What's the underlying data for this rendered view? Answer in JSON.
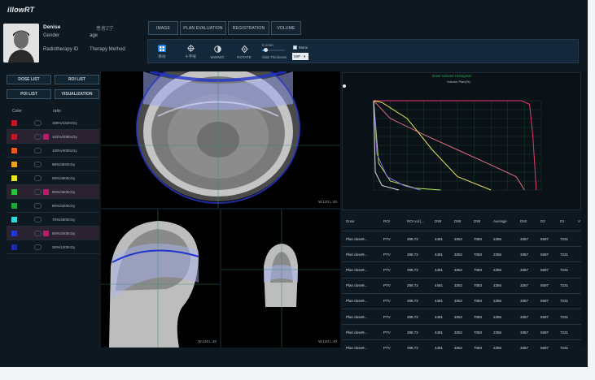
{
  "app": {
    "logo": "iIlowRT"
  },
  "patient": {
    "name": "Denise",
    "name_cn": "患者Z宁",
    "gender_label": "Gender",
    "age_label": "age",
    "radiotherapy_id_label": "Radiotherapy ID",
    "therapy_method_label": "Therapy Method"
  },
  "top_tabs": [
    "IMAGE",
    "PLAN EVALUATION",
    "REGISTRATION",
    "VOLUME"
  ],
  "toolbar": {
    "tools": [
      {
        "label": "移动",
        "icon": "grid-icon",
        "active": true
      },
      {
        "label": "十字线",
        "icon": "crosshair-icon",
        "active": false
      },
      {
        "label": "WW/WC",
        "icon": "contrast-icon",
        "active": false
      },
      {
        "label": "ROTATE",
        "icon": "rotate-icon",
        "active": false
      }
    ],
    "slab_thickness_label": "Slab Thickness",
    "slab_value": "0.1mm",
    "mono_label": "Mono",
    "mip_value": "MIP"
  },
  "left_panel": {
    "buttons": [
      "DOSE LIST",
      "ROI LIST",
      "POI LIST",
      "VISUALIZATION"
    ],
    "col_color": "Color",
    "col_ratio": "ratio",
    "rows": [
      {
        "color": "#c2172a",
        "flag": "",
        "ratio": "108%/4320cGy"
      },
      {
        "color": "#c2172a",
        "flag": "#c2176a",
        "ratio": "102%/4080cGy"
      },
      {
        "color": "#e8581a",
        "flag": "",
        "ratio": "100%/4000cGy"
      },
      {
        "color": "#f0a020",
        "flag": "",
        "ratio": "98%/3920cGy"
      },
      {
        "color": "#e6e61a",
        "flag": "",
        "ratio": "95%/3800cGy"
      },
      {
        "color": "#27c43a",
        "flag": "#c2176a",
        "ratio": "90%/3600cGy"
      },
      {
        "color": "#1fa83a",
        "flag": "",
        "ratio": "80%/3200cGy"
      },
      {
        "color": "#2fd6e0",
        "flag": "",
        "ratio": "70%/2800cGy"
      },
      {
        "color": "#2436d8",
        "flag": "#c2176a",
        "ratio": "50%/2000cGy"
      },
      {
        "color": "#1a2aa8",
        "flag": "",
        "ratio": "30%/1200cGy"
      }
    ]
  },
  "viewers": {
    "axial_wl": "W:120 L:40",
    "sagittal_wl": "W:120 L:40",
    "coronal_wl": "W:120 L:40"
  },
  "dvh": {
    "title": "Dose Volume Histogram",
    "subtitle": "Volume Plan(%)"
  },
  "chart_data": {
    "type": "line",
    "title": "Dose Volume Histogram",
    "ylabel": "Volume Plan(%)",
    "xlim": [
      0,
      100
    ],
    "ylim": [
      0,
      100
    ],
    "grid": true,
    "series": [
      {
        "color": "#e33a6a",
        "x": [
          0,
          88,
          93,
          95,
          97
        ],
        "y": [
          100,
          100,
          96,
          60,
          0
        ]
      },
      {
        "color": "#e06a82",
        "x": [
          0,
          10,
          30,
          50,
          70,
          85,
          90
        ],
        "y": [
          100,
          80,
          62,
          45,
          28,
          15,
          0
        ]
      },
      {
        "color": "#e6e25a",
        "x": [
          0,
          5,
          20,
          35,
          50,
          70
        ],
        "y": [
          100,
          98,
          80,
          45,
          15,
          0
        ]
      },
      {
        "color": "#b5e35a",
        "x": [
          0,
          3,
          10,
          25,
          40
        ],
        "y": [
          100,
          30,
          10,
          2,
          0
        ]
      },
      {
        "color": "#8a6ae0",
        "x": [
          0,
          2,
          8,
          18,
          28
        ],
        "y": [
          100,
          40,
          15,
          5,
          0
        ]
      },
      {
        "color": "#e0e0e0",
        "x": [
          0,
          1,
          5,
          15
        ],
        "y": [
          100,
          20,
          5,
          0
        ]
      }
    ]
  },
  "table": {
    "headers": [
      "Dose",
      "ROI",
      "ROI vol.[...",
      "D99",
      "D98",
      "D95",
      "Average",
      "D50",
      "D2",
      "D1",
      "V"
    ],
    "rows": [
      [
        "Plan dose9...",
        "PTV",
        "298.72",
        "4481",
        "3352",
        "7083",
        "2356",
        "3367",
        "5597",
        "7231"
      ],
      [
        "Plan dose9...",
        "PTV",
        "298.72",
        "4481",
        "3352",
        "7083",
        "2356",
        "3367",
        "5597",
        "7231"
      ],
      [
        "Plan dose9...",
        "PTV",
        "298.72",
        "4481",
        "3352",
        "7083",
        "2356",
        "3367",
        "5597",
        "7231"
      ],
      [
        "Plan dose9...",
        "PTV",
        "298.72",
        "4481",
        "3352",
        "7083",
        "2356",
        "3367",
        "5597",
        "7231"
      ],
      [
        "Plan dose9...",
        "PTV",
        "298.72",
        "4481",
        "3352",
        "7083",
        "2356",
        "3367",
        "5597",
        "7231"
      ],
      [
        "Plan dose9...",
        "PTV",
        "298.72",
        "4481",
        "3352",
        "7083",
        "2356",
        "3367",
        "5597",
        "7231"
      ],
      [
        "Plan dose9...",
        "PTV",
        "298.72",
        "4481",
        "3352",
        "7083",
        "2356",
        "3367",
        "5597",
        "7231"
      ],
      [
        "Plan dose9...",
        "PTV",
        "298.72",
        "4481",
        "3352",
        "7083",
        "2356",
        "3367",
        "5597",
        "7231"
      ]
    ]
  }
}
